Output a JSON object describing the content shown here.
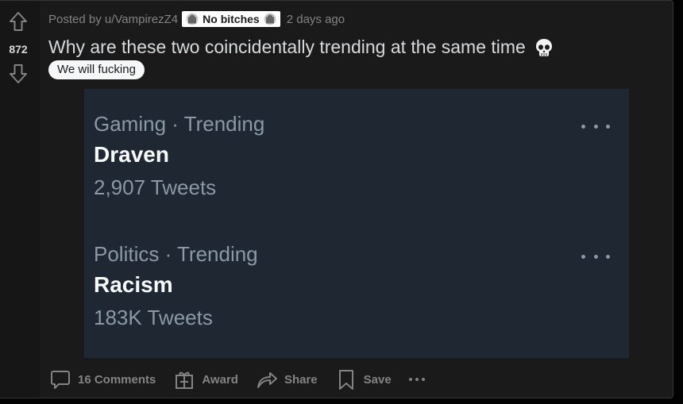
{
  "vote": {
    "score": "872"
  },
  "meta": {
    "posted_by": "Posted by u/VampirezZ4",
    "user_flair": "No bitches",
    "user_flair_icon": "skeleton-hands-icon",
    "time": "2 days ago"
  },
  "post": {
    "title": "Why are these two coincidentally trending at the same time",
    "title_emoji_icon": "skull-icon",
    "flair": "We will fucking"
  },
  "media": {
    "trends": [
      {
        "context": "Gaming · Trending",
        "name": "Draven",
        "count": "2,907 Tweets"
      },
      {
        "context": "Politics · Trending",
        "name": "Racism",
        "count": "183K Tweets"
      }
    ]
  },
  "actions": {
    "comments_label": "16 Comments",
    "award_label": "Award",
    "share_label": "Share",
    "save_label": "Save"
  },
  "colors": {
    "page_bg": "#030303",
    "post_bg": "#1a1a1b",
    "media_bg": "#1e2732",
    "text_primary": "#d7dadc",
    "text_muted": "#818384",
    "tweet_muted": "#8b98a5"
  }
}
